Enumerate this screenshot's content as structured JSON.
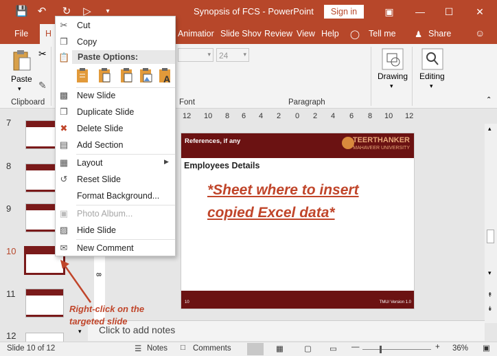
{
  "window": {
    "title": "Synopsis of FCS  -  PowerPoint",
    "signin": "Sign in"
  },
  "tabs": {
    "file": "File",
    "home": "H",
    "animations": "Animatior",
    "slideshow": "Slide Shov",
    "review": "Review",
    "view": "View",
    "help": "Help",
    "tellme": "Tell me",
    "share": "Share"
  },
  "ribbon": {
    "paste": "Paste",
    "clipboard": "Clipboard",
    "font_size": "24",
    "font_group": "Font",
    "paragraph_group": "Paragraph",
    "drawing": "Drawing",
    "editing": "Editing"
  },
  "ruler": {
    "ticks": [
      "12",
      "10",
      "8",
      "6",
      "4",
      "2",
      "0",
      "2",
      "4",
      "6",
      "8",
      "10",
      "12"
    ],
    "vticks": [
      "8"
    ]
  },
  "thumbnails": [
    {
      "num": "7"
    },
    {
      "num": "8"
    },
    {
      "num": "9"
    },
    {
      "num": "10"
    },
    {
      "num": "11"
    },
    {
      "num": "12"
    }
  ],
  "slide": {
    "header_text": "References, if any",
    "logo_line1": "TEERTHANKER",
    "logo_line2": "MAHAVEER UNIVERSITY",
    "title": "Employees Details",
    "note": "*Sheet where to insert copied Excel data*",
    "number": "10",
    "version": "TMU/ Version 1.0"
  },
  "context_menu": {
    "cut": "Cut",
    "copy": "Copy",
    "paste_options": "Paste Options:",
    "new_slide": "New Slide",
    "duplicate_slide": "Duplicate Slide",
    "delete_slide": "Delete Slide",
    "add_section": "Add Section",
    "layout": "Layout",
    "reset_slide": "Reset Slide",
    "format_background": "Format Background...",
    "photo_album": "Photo Album...",
    "hide_slide": "Hide Slide",
    "new_comment": "New Comment"
  },
  "annotation": {
    "line1": "Right-click on the",
    "line2": "targeted slide"
  },
  "notes": {
    "placeholder": "Click to add notes"
  },
  "status": {
    "slide_info": "Slide 10 of 12",
    "notes": "Notes",
    "comments": "Comments",
    "zoom": "36%"
  },
  "colors": {
    "accent": "#b7472a",
    "slide_band": "#6b1212",
    "annotation": "#c0452a"
  }
}
